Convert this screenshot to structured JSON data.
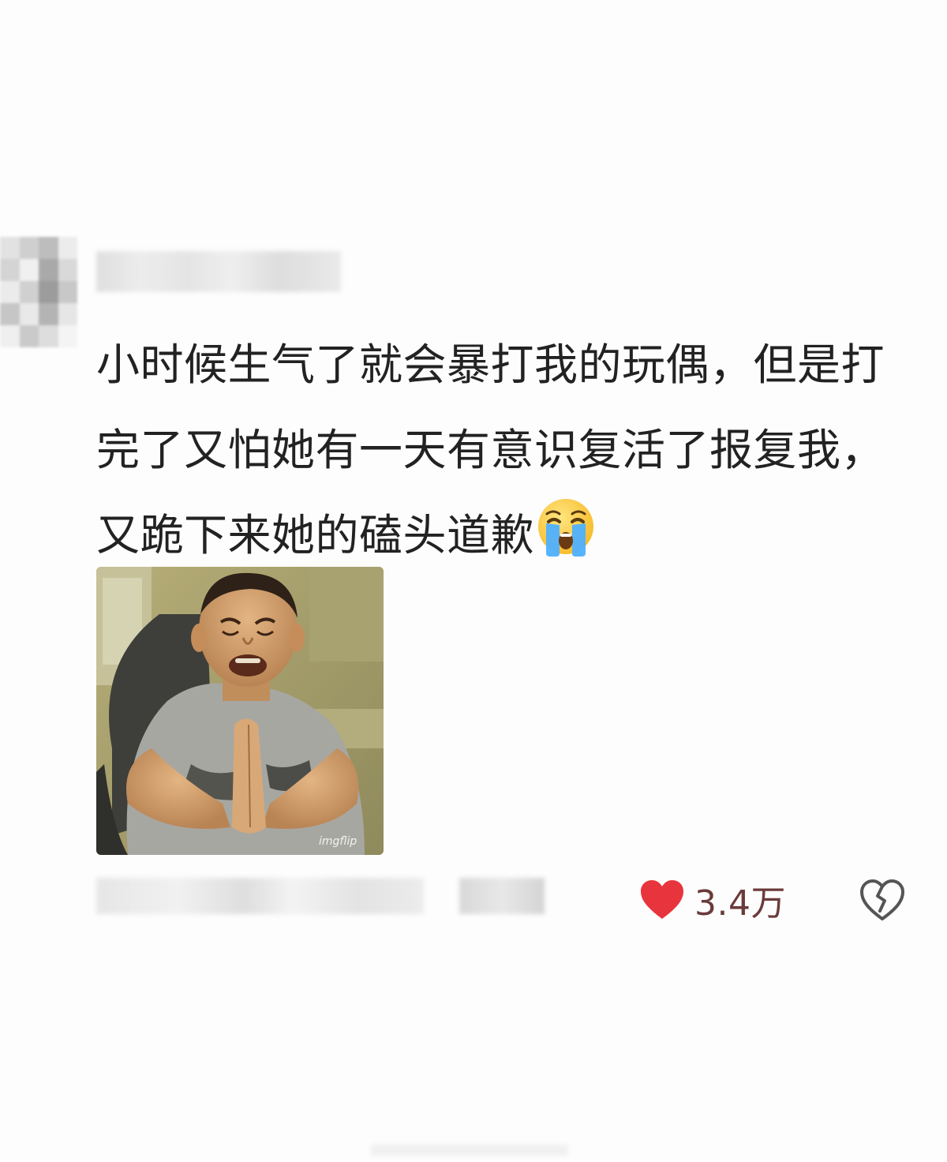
{
  "comment": {
    "text": "小时候生气了就会暴打我的玩偶，但是打完了又怕她有一天有意识复活了报复我，又跪下来她的磕头道歉",
    "emoji": "loudly-crying-face-icon"
  },
  "actions": {
    "like_count": "3.4万",
    "like_icon": "heart-icon",
    "dislike_icon": "broken-heart-icon",
    "like_color": "#e8343d"
  },
  "attachment": {
    "watermark": "imgflip"
  }
}
